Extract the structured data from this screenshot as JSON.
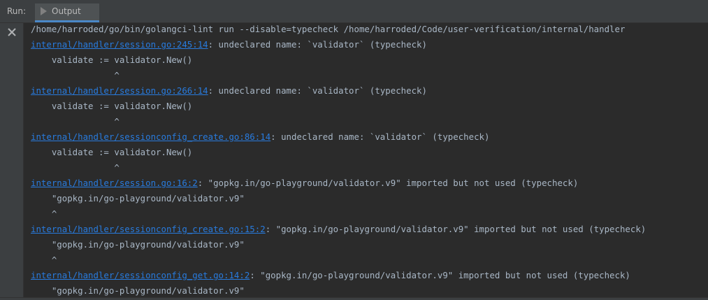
{
  "toolbar": {
    "run_label": "Run:",
    "tab_label": "Output"
  },
  "console": {
    "command": "/home/harroded/go/bin/golangci-lint run --disable=typecheck /home/harroded/Code/user-verification/internal/handler",
    "lines": [
      {
        "link": "internal/handler/session.go:245:14",
        "text": ": undeclared name: `validator` (typecheck)"
      },
      {
        "text": "    validate := validator.New()"
      },
      {
        "text": "                ^"
      },
      {
        "link": "internal/handler/session.go:266:14",
        "text": ": undeclared name: `validator` (typecheck)"
      },
      {
        "text": "    validate := validator.New()"
      },
      {
        "text": "                ^"
      },
      {
        "link": "internal/handler/sessionconfig_create.go:86:14",
        "text": ": undeclared name: `validator` (typecheck)"
      },
      {
        "text": "    validate := validator.New()"
      },
      {
        "text": "                ^"
      },
      {
        "link": "internal/handler/session.go:16:2",
        "text": ": \"gopkg.in/go-playground/validator.v9\" imported but not used (typecheck)"
      },
      {
        "text": "    \"gopkg.in/go-playground/validator.v9\""
      },
      {
        "text": "    ^"
      },
      {
        "link": "internal/handler/sessionconfig_create.go:15:2",
        "text": ": \"gopkg.in/go-playground/validator.v9\" imported but not used (typecheck)"
      },
      {
        "text": "    \"gopkg.in/go-playground/validator.v9\""
      },
      {
        "text": "    ^"
      },
      {
        "link": "internal/handler/sessionconfig_get.go:14:2",
        "text": ": \"gopkg.in/go-playground/validator.v9\" imported but not used (typecheck)"
      },
      {
        "text": "    \"gopkg.in/go-playground/validator.v9\""
      }
    ]
  },
  "colors": {
    "background": "#2b2b2b",
    "text": "#a9b7c6",
    "link": "#287bde",
    "tab_underline": "#4a88c7"
  },
  "icons": {
    "tab": "play-icon",
    "gutter": "close-icon"
  }
}
